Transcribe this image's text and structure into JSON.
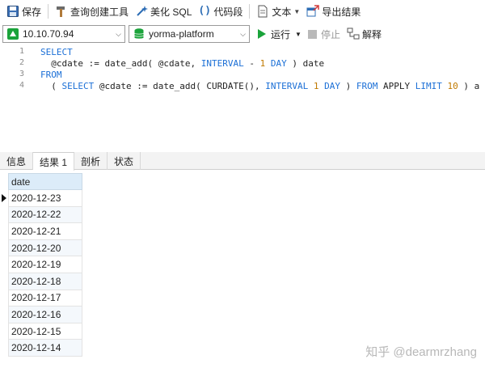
{
  "toolbar": {
    "save_label": "保存",
    "query_builder_label": "查询创建工具",
    "beautify_label": "美化 SQL",
    "snippet_label": "代码段",
    "text_label": "文本",
    "export_label": "导出结果"
  },
  "connection": {
    "host": "10.10.70.94",
    "database": "yorma-platform",
    "run_label": "运行",
    "stop_label": "停止",
    "explain_label": "解释"
  },
  "editor": {
    "lines": [
      {
        "no": "1",
        "text": "SELECT"
      },
      {
        "no": "2",
        "text": "  @cdate := date_add( @cdate, INTERVAL - 1 DAY ) date"
      },
      {
        "no": "3",
        "text": "FROM"
      },
      {
        "no": "4",
        "text": "  ( SELECT @cdate := date_add( CURDATE(), INTERVAL 1 DAY ) FROM APPLY LIMIT 10 ) a"
      }
    ]
  },
  "tabs": [
    {
      "label": "信息"
    },
    {
      "label": "结果 1"
    },
    {
      "label": "剖析"
    },
    {
      "label": "状态"
    }
  ],
  "results": {
    "column": "date",
    "rows": [
      "2020-12-23",
      "2020-12-22",
      "2020-12-21",
      "2020-12-20",
      "2020-12-19",
      "2020-12-18",
      "2020-12-17",
      "2020-12-16",
      "2020-12-15",
      "2020-12-14"
    ]
  },
  "watermark": "知乎 @dearmrzhang",
  "colors": {
    "keyword": "#1b6fd6",
    "number": "#c07a00",
    "header_bg": "#dcecf9",
    "run_green": "#1aa33a"
  }
}
